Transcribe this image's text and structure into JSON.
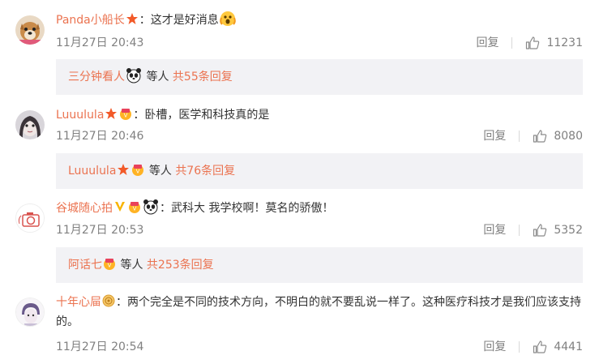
{
  "comments": [
    {
      "username": "Panda小船长",
      "badges": [
        "star-badge"
      ],
      "colon": "：",
      "text": "这才是好消息",
      "trailing_emoji": "surprised-emoji",
      "time": "11月27日 20:43",
      "reply_label": "回复",
      "likes": "11231",
      "sub": {
        "user": "三分钟看人",
        "user_badges": [
          "panda-emoji"
        ],
        "deng": "等人",
        "more": "共55条回复"
      }
    },
    {
      "username": "Luuulula",
      "badges": [
        "star-badge",
        "vip-badge"
      ],
      "colon": "：",
      "text": "卧槽，医学和科技真的是",
      "time": "11月27日 20:46",
      "reply_label": "回复",
      "likes": "8080",
      "sub": {
        "user": "Luuulula",
        "user_badges": [
          "star-badge",
          "vip-badge"
        ],
        "deng": "等人",
        "more": "共76条回复"
      }
    },
    {
      "username": "谷城随心拍",
      "badges": [
        "verified-v-badge",
        "vip-badge",
        "panda-emoji"
      ],
      "colon": "：",
      "text": "武科大 我学校啊！莫名的骄傲！",
      "time": "11月27日 20:53",
      "reply_label": "回复",
      "likes": "5352",
      "sub": {
        "user": "阿话七",
        "user_badges": [
          "vip-badge"
        ],
        "deng": "等人",
        "more": "共253条回复"
      }
    },
    {
      "username": "十年心屇",
      "badges": [
        "level-medal-badge"
      ],
      "colon": "：",
      "text": "两个完全是不同的技术方向，不明白的就不要乱说一样了。这种医疗科技才是我们应该支持的。",
      "time": "11月27日 20:54",
      "reply_label": "回复",
      "likes": "4441"
    }
  ],
  "colors": {
    "username": "#eb7350",
    "meta": "#808080",
    "sub_bg": "#f2f2f5"
  }
}
